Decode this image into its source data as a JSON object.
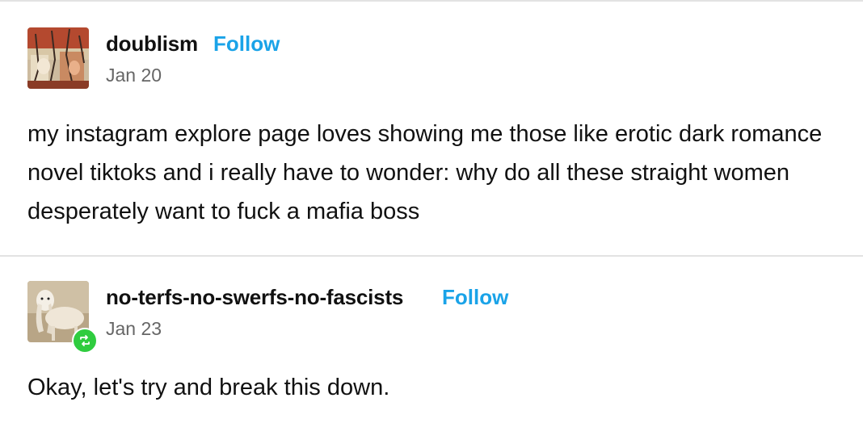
{
  "posts": [
    {
      "username": "doublism",
      "follow_label": "Follow",
      "date": "Jan 20",
      "text": "my instagram explore page loves showing me those like erotic dark romance novel tiktoks and i really have to wonder: why do all these straight women desperately want to fuck a mafia boss",
      "avatar_icon": "collage-avatar"
    },
    {
      "username": "no-terfs-no-swerfs-no-fascists",
      "follow_label": "Follow",
      "date": "Jan 23",
      "text": "Okay, let's try and break this down.",
      "avatar_icon": "goat-avatar",
      "badge_icon": "reblog-icon"
    }
  ],
  "colors": {
    "follow": "#1aa3e8",
    "reblog_badge": "#2fcc3f",
    "divider": "#e2e2e2"
  }
}
